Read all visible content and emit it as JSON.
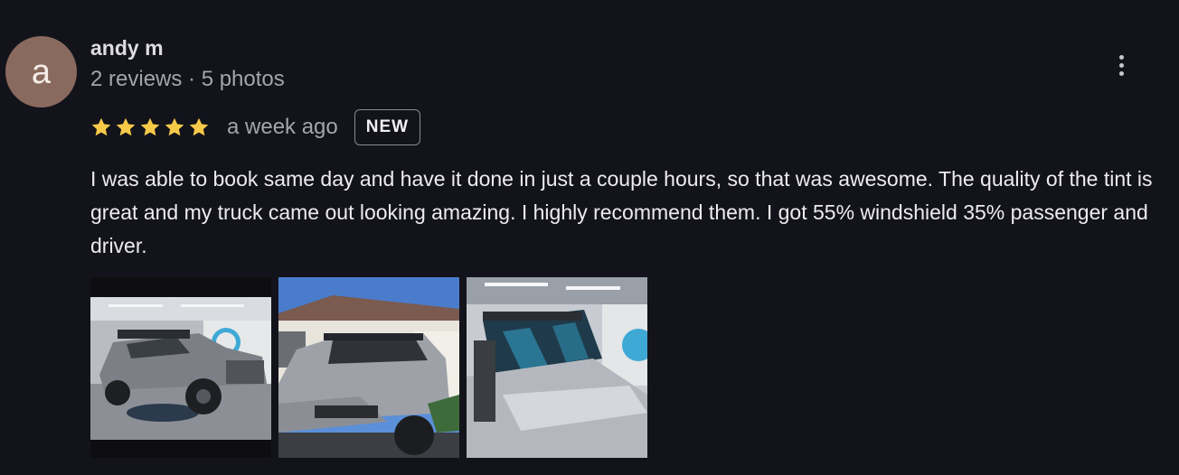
{
  "review": {
    "author": {
      "avatar_letter": "a",
      "name": "andy m",
      "meta": "2 reviews · 5 photos"
    },
    "rating": 5,
    "time_ago": "a week ago",
    "badge": "NEW",
    "text": "I was able to book same day and have it done in just a couple hours, so that was awesome. The quality of the tint is great and my truck came out looking amazing. I highly recommend them. I got 55% windshield 35% passenger and driver.",
    "photos": [
      {
        "subject": "silver truck in white tint shop"
      },
      {
        "subject": "silver truck front outdoors"
      },
      {
        "subject": "truck windshield close-up"
      }
    ]
  },
  "colors": {
    "background": "#13131b",
    "star": "#f7c948",
    "avatar": "#8a6a5e"
  },
  "icons": [
    "star-icon",
    "more-vert-icon"
  ]
}
